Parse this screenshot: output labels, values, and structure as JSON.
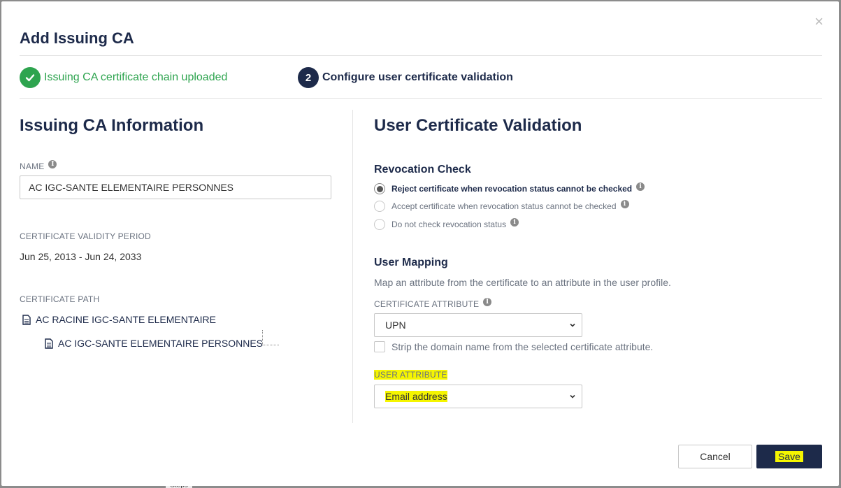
{
  "backdrop": {
    "tab_label": "Steps"
  },
  "dialog": {
    "title": "Add Issuing CA",
    "close_label": "×"
  },
  "steps": [
    {
      "label": "Issuing CA certificate chain uploaded",
      "status": "completed"
    },
    {
      "number": "2",
      "label": "Configure user certificate validation",
      "status": "current"
    }
  ],
  "issuing_ca": {
    "heading": "Issuing CA Information",
    "name_label": "NAME",
    "name_value": "AC IGC-SANTE ELEMENTAIRE PERSONNES",
    "validity_label": "CERTIFICATE VALIDITY PERIOD",
    "validity_value": "Jun 25, 2013 - Jun 24, 2033",
    "path_label": "CERTIFICATE PATH",
    "path": [
      "AC RACINE IGC-SANTE ELEMENTAIRE",
      "AC IGC-SANTE ELEMENTAIRE PERSONNES"
    ]
  },
  "validation": {
    "heading": "User Certificate Validation",
    "revocation": {
      "heading": "Revocation Check",
      "options": [
        {
          "label": "Reject certificate when revocation status cannot be checked",
          "selected": true
        },
        {
          "label": "Accept certificate when revocation status cannot be checked",
          "selected": false
        },
        {
          "label": "Do not check revocation status",
          "selected": false
        }
      ]
    },
    "mapping": {
      "heading": "User Mapping",
      "description": "Map an attribute from the certificate to an attribute in the user profile.",
      "cert_attr_label": "CERTIFICATE ATTRIBUTE",
      "cert_attr_value": "UPN",
      "strip_domain_label": "Strip the domain name from the selected certificate attribute.",
      "strip_domain_checked": false,
      "user_attr_label": "USER ATTRIBUTE",
      "user_attr_value": "Email address"
    }
  },
  "footer": {
    "cancel_label": "Cancel",
    "save_label": "Save"
  },
  "colors": {
    "navy": "#1d2a4a",
    "success": "#2ea44f",
    "highlight": "#f5f500"
  },
  "icons": [
    "close-icon",
    "checkmark-icon",
    "info-icon",
    "document-icon",
    "chevron-down-icon"
  ]
}
